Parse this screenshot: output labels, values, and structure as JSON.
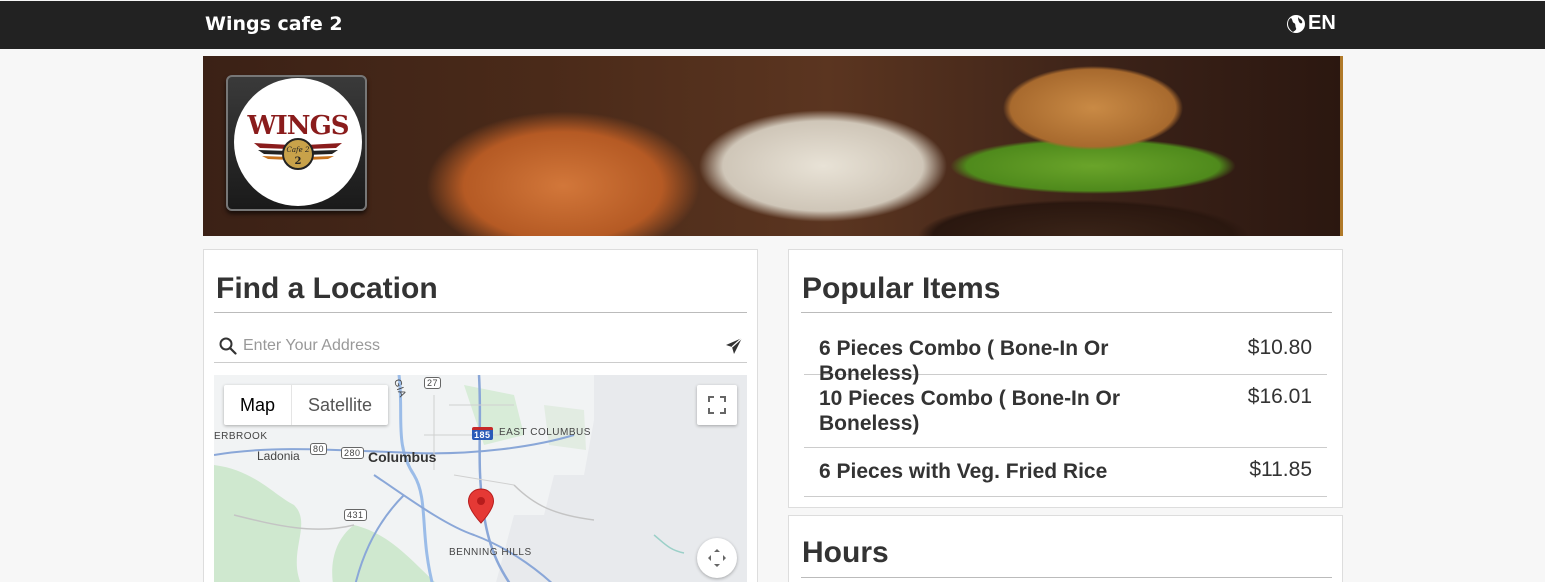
{
  "header": {
    "brand": "Wings cafe 2",
    "language": "EN",
    "language_icon": "globe-icon"
  },
  "banner": {
    "logo_text": "WINGS",
    "logo_sub": "Cafe 2"
  },
  "find_location": {
    "title": "Find a Location",
    "search_placeholder": "Enter Your Address",
    "map_tabs": [
      "Map",
      "Satellite"
    ],
    "map_labels": {
      "city": "Columbus",
      "east_columbus": "EAST COLUMBUS",
      "ladonia": "Ladonia",
      "benning_hills": "BENNING HILLS",
      "erbrook": "ERBROOK",
      "georgia": "GIA",
      "route_27": "27",
      "route_80": "80",
      "route_280": "280",
      "route_431": "431",
      "route_185": "185"
    }
  },
  "popular": {
    "title": "Popular Items",
    "items": [
      {
        "name": "6 Pieces Combo ( Bone-In Or Boneless)",
        "price": "$10.80"
      },
      {
        "name": "10 Pieces Combo ( Bone-In Or Boneless)",
        "price": "$16.01"
      },
      {
        "name": "6 Pieces with Veg. Fried Rice",
        "price": "$11.85"
      }
    ]
  },
  "hours": {
    "title": "Hours"
  },
  "colors": {
    "topbar": "#222222",
    "pin": "#e53935",
    "logo_red": "#8a1c1c"
  }
}
